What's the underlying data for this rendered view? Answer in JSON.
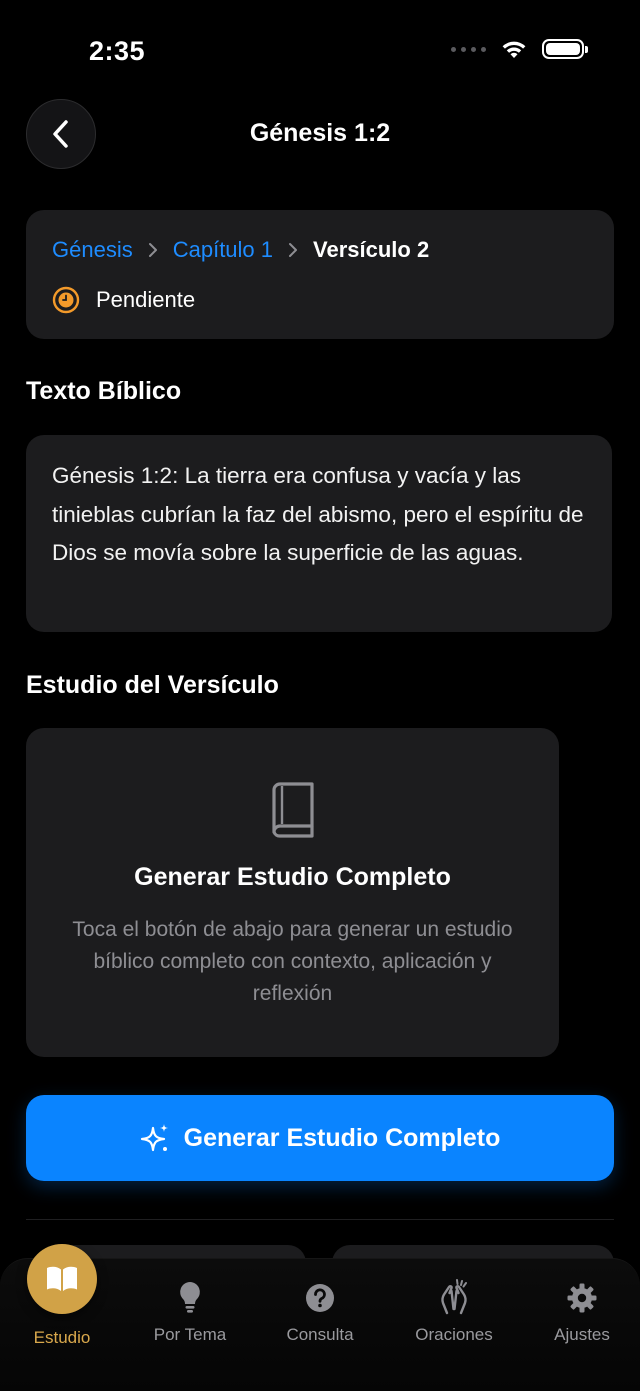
{
  "status_bar": {
    "time": "2:35"
  },
  "header": {
    "title": "Génesis 1:2"
  },
  "breadcrumb": {
    "book": "Génesis",
    "chapter": "Capítulo 1",
    "verse": "Versículo 2"
  },
  "status": {
    "label": "Pendiente",
    "color": "#f39a2a"
  },
  "sections": {
    "text_title": "Texto Bíblico",
    "study_title": "Estudio del Versículo"
  },
  "verse": {
    "text": "Génesis 1:2: La tierra era confusa y vacía y las tinieblas cubrían la faz del abismo, pero el espíritu de Dios se movía sobre la superficie de las aguas."
  },
  "study_card": {
    "icon": "book-icon",
    "title": "Generar Estudio Completo",
    "description": "Toca el botón de abajo para generar un estudio bíblico completo con contexto, aplicación y reflexión"
  },
  "generate_button": {
    "label": "Generar Estudio Completo",
    "icon": "sparkles-icon",
    "color": "#0a84ff"
  },
  "tabs": [
    {
      "label": "Estudio",
      "icon": "book-open-icon",
      "active": true
    },
    {
      "label": "Por Tema",
      "icon": "lightbulb-icon",
      "active": false
    },
    {
      "label": "Consulta",
      "icon": "question-circle-icon",
      "active": false
    },
    {
      "label": "Oraciones",
      "icon": "praying-hands-icon",
      "active": false
    },
    {
      "label": "Ajustes",
      "icon": "gear-icon",
      "active": false
    }
  ],
  "colors": {
    "accent": "#0a84ff",
    "active_tab": "#d1a247",
    "link": "#1e8cff"
  }
}
